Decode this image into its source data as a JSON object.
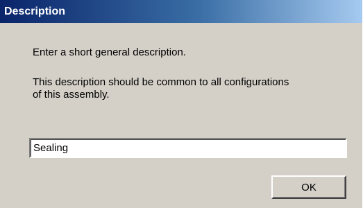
{
  "dialog": {
    "title": "Description",
    "prompt": "Enter a short general description.",
    "note": "This description should be common to all configurations of this assembly.",
    "description_input": {
      "value": "Sealing"
    },
    "ok_label": "OK"
  }
}
